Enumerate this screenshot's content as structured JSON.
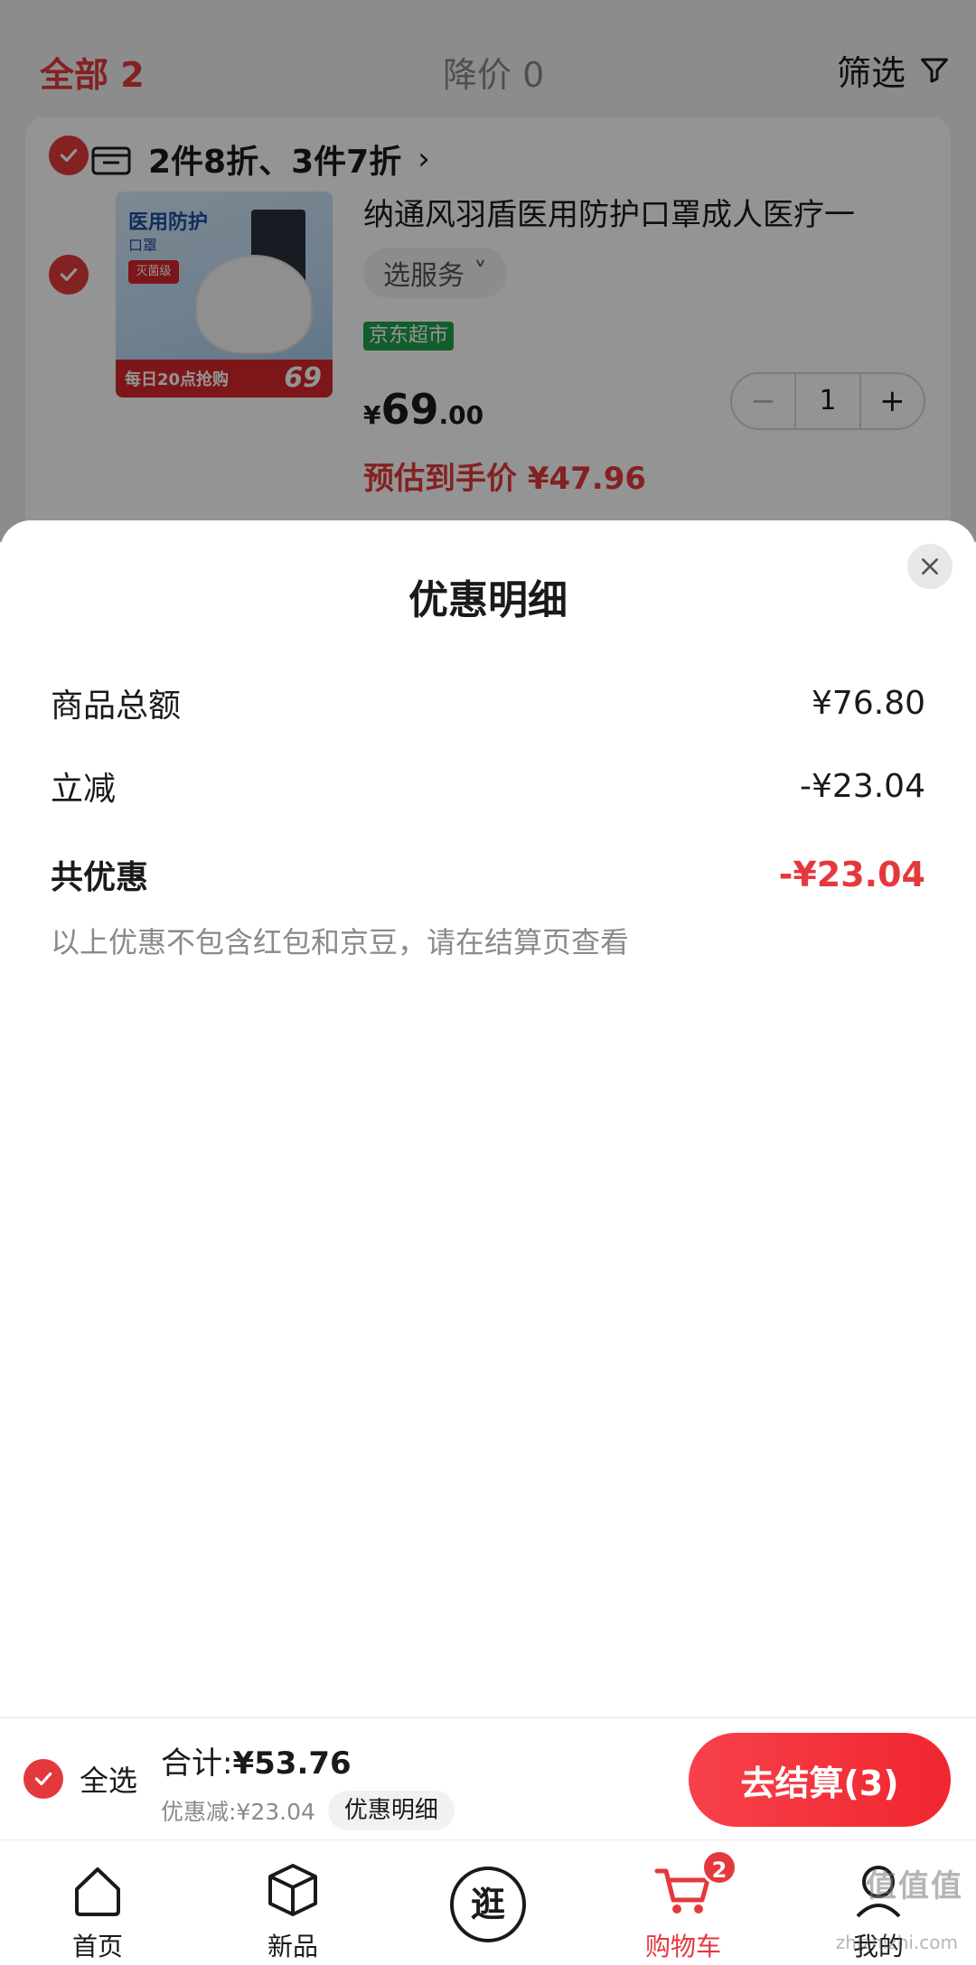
{
  "filter_bar": {
    "tab_all": "全部 2",
    "tab_price_drop": "降价 0",
    "filter_label": "筛选"
  },
  "cart_item": {
    "promo": "2件8折、3件7折",
    "promo_chevron": "›",
    "thumb": {
      "title": "医用防护",
      "subtitle": "口罩",
      "badge": "灭菌级",
      "band_text": "每日20点抢购",
      "band_price": "69"
    },
    "title": "纳通风羽盾医用防护口罩成人医疗一",
    "service_label": "选服务",
    "service_chevron": "˅",
    "store_tag": "京东超市",
    "price_currency": "¥",
    "price_int": "69",
    "price_dec": ".00",
    "quantity": "1",
    "minus": "−",
    "plus": "+",
    "est_price": "预估到手价 ¥47.96"
  },
  "sheet": {
    "title": "优惠明细",
    "rows": [
      {
        "label": "商品总额",
        "value": "¥76.80"
      },
      {
        "label": "立减",
        "value": "-¥23.04"
      },
      {
        "label": "共优惠",
        "value": "-¥23.04"
      }
    ],
    "note": "以上优惠不包含红包和京豆，请在结算页查看"
  },
  "checkout": {
    "select_all": "全选",
    "sum_label": "合计:",
    "sum_value": "¥53.76",
    "discount_text": "优惠减:¥23.04",
    "detail_pill": "优惠明细",
    "checkout_button": "去结算(3)"
  },
  "tabbar": {
    "items": [
      {
        "label": "首页",
        "icon": "home-icon"
      },
      {
        "label": "新品",
        "icon": "cube-icon"
      },
      {
        "label": "逛",
        "icon": "explore-icon"
      },
      {
        "label": "购物车",
        "icon": "cart-icon",
        "badge": "2"
      },
      {
        "label": "我的",
        "icon": "user-icon"
      }
    ]
  },
  "watermark": {
    "text": "值值值",
    "sub": "zhizhizhi.com"
  },
  "colors": {
    "accent": "#e4393c",
    "store_tag": "#1fa14b"
  }
}
